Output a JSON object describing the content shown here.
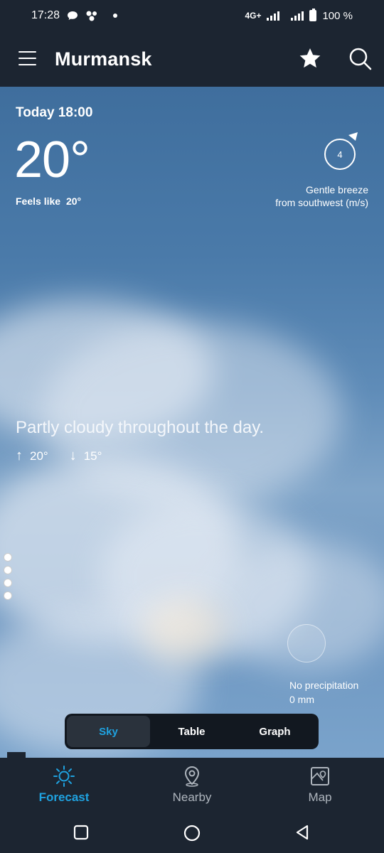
{
  "status_bar": {
    "time": "17:28",
    "network": "4G+",
    "battery": "100 %",
    "icons": [
      "chat-bubble-icon",
      "app-cluster-icon",
      "dot-icon",
      "signal-icon",
      "signal-icon",
      "battery-icon"
    ]
  },
  "app_bar": {
    "city": "Murmansk",
    "icons": [
      "menu-icon",
      "star-icon",
      "search-icon"
    ]
  },
  "current": {
    "time_label": "Today 18:00",
    "temperature": "20°",
    "feels_like_label": "Feels like",
    "feels_like_value": "20°"
  },
  "wind": {
    "speed": "4",
    "description_line1": "Gentle breeze",
    "description_line2": "from southwest (m/s)"
  },
  "summary": {
    "text": "Partly cloudy throughout the day.",
    "high": "20°",
    "low": "15°"
  },
  "precipitation": {
    "line1": "No precipitation",
    "line2": "0 mm"
  },
  "view_tabs": {
    "selected": "Sky",
    "items": [
      "Sky",
      "Table",
      "Graph"
    ]
  },
  "bottom_nav": {
    "selected": "Forecast",
    "items": [
      "Forecast",
      "Nearby",
      "Map"
    ],
    "accent": "#1fa2e0"
  },
  "system_nav": [
    "square-icon",
    "circle-icon",
    "back-triangle-icon"
  ]
}
